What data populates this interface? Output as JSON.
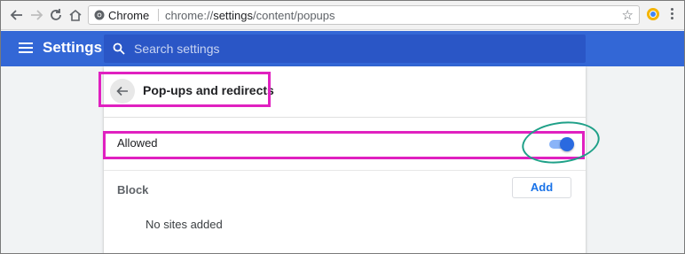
{
  "browser": {
    "omnibox": {
      "scheme_label": "Chrome",
      "url_prefix": "chrome://",
      "url_host": "settings",
      "url_path": "/content/popups"
    },
    "icons": {
      "back": "back-arrow-icon",
      "forward": "forward-arrow-icon",
      "reload": "reload-icon",
      "home": "home-icon",
      "site_info": "chrome-logo-icon",
      "bookmark": "star-icon",
      "extension": "extension-icon",
      "menu": "kebab-menu-icon"
    }
  },
  "header": {
    "title": "Settings",
    "search_placeholder": "Search settings",
    "brand_color": "#3367d6"
  },
  "page": {
    "title": "Pop-ups and redirects",
    "allowed_label": "Allowed",
    "allowed_toggle_on": true,
    "block_label": "Block",
    "add_button_label": "Add",
    "empty_message": "No sites added"
  },
  "annotations": {
    "highlight_color": "#e020c0",
    "circle_color": "#1fa088"
  }
}
